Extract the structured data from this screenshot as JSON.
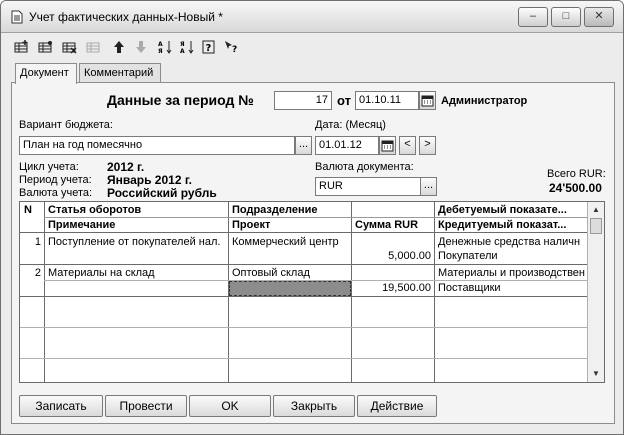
{
  "window": {
    "title": "Учет фактических данных-Новый *"
  },
  "tabs": [
    {
      "label": "Документ"
    },
    {
      "label": "Комментарий"
    }
  ],
  "header": {
    "period_label": "Данные за  период №",
    "number": "17",
    "from_label": "от",
    "date": "01.10.11",
    "user": "Администратор"
  },
  "budget": {
    "label": "Вариант бюджета:",
    "value": "План на год помесячно"
  },
  "month": {
    "label": "Дата: (Месяц)",
    "value": "01.01.12"
  },
  "info": {
    "cycle_label": "Цикл учета:",
    "cycle_value": "2012 г.",
    "period_label": "Период учета:",
    "period_value": "Январь 2012 г.",
    "currency_label": "Валюта учета:",
    "currency_value": "Российский рубль"
  },
  "doc_currency": {
    "label": "Валюта документа:",
    "value": "RUR"
  },
  "total": {
    "label": "Всего RUR:",
    "value": "24'500.00"
  },
  "table": {
    "headers_top": [
      "N",
      "Статья оборотов",
      "Подразделение",
      "",
      "Дебетуемый показате..."
    ],
    "headers_bottom": [
      "",
      "Примечание",
      "Проект",
      "Сумма RUR",
      "Кредитуемый показат..."
    ],
    "rows": [
      {
        "n": "1",
        "article": "Поступление от покупателей нал.",
        "note": "",
        "division": "Коммерческий центр",
        "project": "",
        "sum": "5,000.00",
        "debit": "Денежные средства наличн",
        "credit": "Покупатели"
      },
      {
        "n": "2",
        "article": "Материалы на склад",
        "note": "",
        "division": "Оптовый склад",
        "project": "",
        "sum": "19,500.00",
        "debit": "Материалы и производствен",
        "credit": "Поставщики"
      }
    ]
  },
  "buttons": {
    "write": "Записать",
    "post": "Провести",
    "ok": "OK",
    "close": "Закрыть",
    "action": "Действие"
  },
  "window_controls": {
    "minimize": "–",
    "maximize": "□",
    "close": "✕"
  },
  "small_buttons": {
    "ellipsis": "...",
    "prev": "<",
    "next": ">"
  }
}
